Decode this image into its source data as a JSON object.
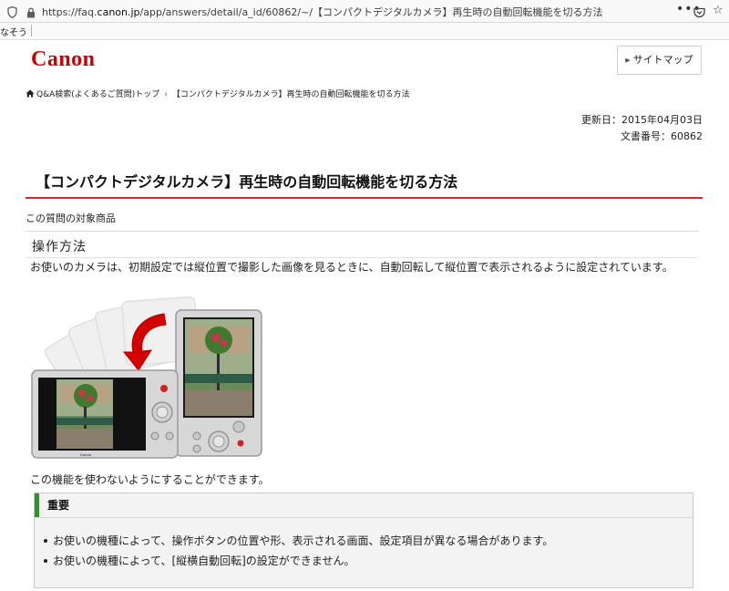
{
  "browser": {
    "url_prefix": "https://faq.",
    "url_domain": "canon.jp",
    "url_suffix": "/app/answers/detail/a_id/60862/~/【コンパクトデジタルカメラ】再生時の自動回転機能を切る方法",
    "more_label": "•••",
    "bookmark_item": "なそう"
  },
  "header": {
    "logo": "Canon",
    "sitemap_label": "サイトマップ"
  },
  "breadcrumb": {
    "items": [
      "Q&A検索(よくあるご質問)トップ",
      "【コンパクトデジタルカメラ】再生時の自動回転機能を切る方法"
    ],
    "separator": "›"
  },
  "meta": {
    "updated": "更新日：2015年04月03日",
    "doc_number": "文書番号：60862"
  },
  "article": {
    "title": "【コンパクトデジタルカメラ】再生時の自動回転機能を切る方法",
    "target_products_label": "この質問の対象商品",
    "section_heading": "操作方法",
    "body": "お使いのカメラは、初期設定では縦位置で撮影した画像を見るときに、自動回転して縦位置で表示されるように設定されています。",
    "illustration_brand": "Canon",
    "can_disable": "この機能を使わないようにすることができます。"
  },
  "important": {
    "heading": "重要",
    "items": [
      "お使いの機種によって、操作ボタンの位置や形、表示される画面、設定項目が異なる場合があります。",
      "お使いの機種によって、[縦横自動回転]の設定ができません。"
    ]
  },
  "colors": {
    "brand_red": "#cc0000",
    "title_rule": "#d02a2a",
    "important_bar": "#3a8a3a",
    "box_bg": "#f3f3f3"
  }
}
